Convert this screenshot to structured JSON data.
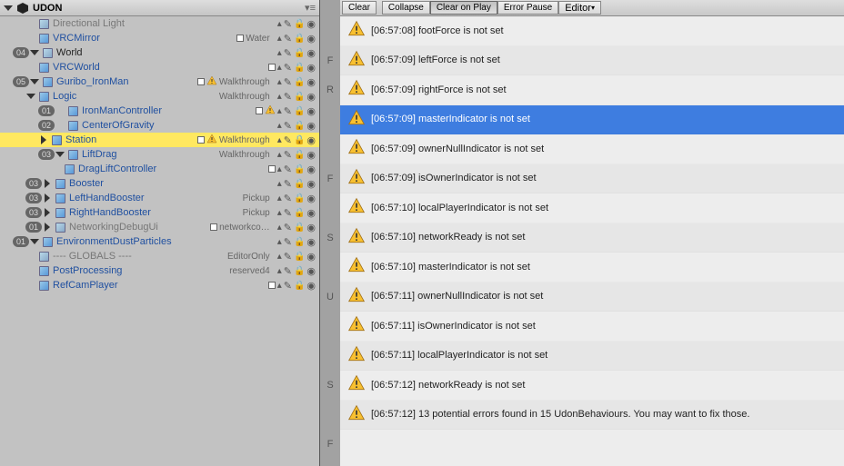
{
  "hierarchy": {
    "title": "UDON",
    "items": [
      {
        "depth": 2,
        "tog": "",
        "label": "Directional Light",
        "prefab": false,
        "tag": "",
        "warn": false,
        "icons": "pleo",
        "gray": true
      },
      {
        "depth": 2,
        "tog": "",
        "label": "VRCMirror",
        "prefab": true,
        "tag": "Water",
        "warn": false,
        "icons": "spleo",
        "extra": "sq"
      },
      {
        "depth": 1,
        "tog": "down",
        "label": "World",
        "prefab": false,
        "tag": "",
        "warn": false,
        "icons": "pleo",
        "badge": "04"
      },
      {
        "depth": 2,
        "tog": "",
        "label": "VRCWorld",
        "prefab": true,
        "tag": "",
        "warn": false,
        "icons": "spleo",
        "extra": "sq"
      },
      {
        "depth": 1,
        "tog": "down",
        "label": "Guribo_IronMan",
        "prefab": true,
        "tag": "Walkthrough",
        "warn": true,
        "icons": "spleo",
        "badge": "05",
        "extra": "sq"
      },
      {
        "depth": 2,
        "tog": "down",
        "label": "Logic",
        "prefab": true,
        "tag": "Walkthrough",
        "warn": false,
        "icons": "pleo"
      },
      {
        "depth": 3,
        "tog": "",
        "label": "IronManController",
        "prefab": true,
        "tag": "",
        "warn": true,
        "icons": "spleo",
        "badge": "01",
        "extra": "sq"
      },
      {
        "depth": 3,
        "tog": "",
        "label": "CenterOfGravity",
        "prefab": true,
        "tag": "",
        "warn": false,
        "icons": "pleo",
        "badge": "02"
      },
      {
        "depth": 3,
        "tog": "r",
        "label": "Station",
        "prefab": true,
        "tag": "Walkthrough",
        "warn": true,
        "icons": "pleo",
        "highlight": true,
        "extra": "sq"
      },
      {
        "depth": 3,
        "tog": "down",
        "label": "LiftDrag",
        "prefab": true,
        "tag": "Walkthrough",
        "warn": false,
        "icons": "pleo",
        "badge": "03"
      },
      {
        "depth": 4,
        "tog": "",
        "label": "DragLiftController",
        "prefab": true,
        "tag": "",
        "warn": false,
        "icons": "spleo",
        "extra": "sq"
      },
      {
        "depth": 2,
        "tog": "r",
        "label": "Booster",
        "prefab": true,
        "tag": "",
        "warn": false,
        "icons": "pleo",
        "badge": "03"
      },
      {
        "depth": 2,
        "tog": "r",
        "label": "LeftHandBooster",
        "prefab": true,
        "tag": "Pickup",
        "warn": false,
        "icons": "pleo",
        "badge": "03"
      },
      {
        "depth": 2,
        "tog": "r",
        "label": "RightHandBooster",
        "prefab": true,
        "tag": "Pickup",
        "warn": false,
        "icons": "pleo",
        "badge": "03"
      },
      {
        "depth": 2,
        "tog": "r",
        "label": "NetworkingDebugUi",
        "prefab": false,
        "tag": "networkco…",
        "warn": false,
        "icons": "spleo",
        "badge": "01",
        "gray": true,
        "extra": "sq"
      },
      {
        "depth": 1,
        "tog": "down",
        "label": "EnvironmentDustParticles",
        "prefab": true,
        "tag": "",
        "warn": false,
        "icons": "pleo",
        "badge": "01"
      },
      {
        "depth": 2,
        "tog": "",
        "label": "---- GLOBALS ----",
        "prefab": false,
        "tag": "EditorOnly",
        "warn": false,
        "icons": "pleo",
        "gray": true
      },
      {
        "depth": 2,
        "tog": "",
        "label": "PostProcessing",
        "prefab": true,
        "tag": "reserved4",
        "warn": false,
        "icons": "pleo"
      },
      {
        "depth": 2,
        "tog": "",
        "label": "RefCamPlayer",
        "prefab": true,
        "tag": "",
        "warn": false,
        "icons": "spleo",
        "extra": "sq"
      }
    ]
  },
  "toolbar": {
    "clear": "Clear",
    "collapse": "Collapse",
    "clear_on_play": "Clear on Play",
    "error_pause": "Error Pause",
    "editor": "Editor"
  },
  "console": [
    {
      "t": "[06:57:08] footForce is not set",
      "sel": false
    },
    {
      "t": "[06:57:09] leftForce is not set",
      "sel": false
    },
    {
      "t": "[06:57:09] rightForce is not set",
      "sel": false
    },
    {
      "t": "[06:57:09] masterIndicator is not set",
      "sel": true
    },
    {
      "t": "[06:57:09] ownerNullIndicator is not set",
      "sel": false
    },
    {
      "t": "[06:57:09] isOwnerIndicator is not set",
      "sel": false
    },
    {
      "t": "[06:57:10] localPlayerIndicator is not set",
      "sel": false
    },
    {
      "t": "[06:57:10] networkReady is not set",
      "sel": false
    },
    {
      "t": "[06:57:10] masterIndicator is not set",
      "sel": false
    },
    {
      "t": "[06:57:11] ownerNullIndicator is not set",
      "sel": false
    },
    {
      "t": "[06:57:11] isOwnerIndicator is not set",
      "sel": false
    },
    {
      "t": "[06:57:11] localPlayerIndicator is not set",
      "sel": false
    },
    {
      "t": "[06:57:12] networkReady is not set",
      "sel": false
    },
    {
      "t": "[06:57:12] 13 potential errors found in 15 UdonBehaviours. You may want to fix those.",
      "sel": false
    }
  ],
  "strip": [
    "",
    "F",
    "R",
    "",
    "",
    "F",
    "",
    "S",
    "",
    "U",
    "",
    "",
    "S",
    "",
    "F"
  ]
}
